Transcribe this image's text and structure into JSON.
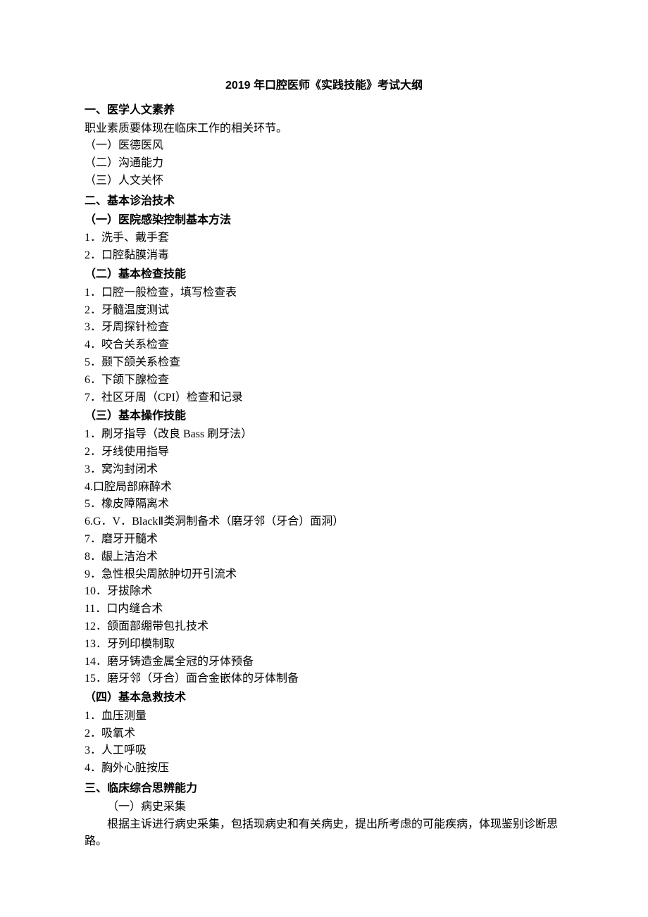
{
  "title": "2019 年口腔医师《实践技能》考试大纲",
  "s1": {
    "heading": "一、医学人文素养",
    "intro": "职业素质要体现在临床工作的相关环节。",
    "items": [
      "（一）医德医风",
      "（二）沟通能力",
      "（三）人文关怀"
    ]
  },
  "s2": {
    "heading": "二、基本诊治技术",
    "sub1": {
      "heading": "（一）医院感染控制基本方法",
      "items": [
        "1．洗手、戴手套",
        "2．口腔黏膜消毒"
      ]
    },
    "sub2": {
      "heading": "（二）基本检查技能",
      "items": [
        "1．口腔一般检查，填写检查表",
        "2．牙髓温度测试",
        "3．牙周探针检查",
        "4．咬合关系检查",
        "5．颞下颌关系检查",
        "6．下颌下腺检查",
        "7．社区牙周（CPI）检查和记录"
      ]
    },
    "sub3": {
      "heading": "（三）基本操作技能",
      "items": [
        "1．刷牙指导（改良 Bass 刷牙法）",
        "2．牙线使用指导",
        "3．窝沟封闭术",
        "4.口腔局部麻醉术",
        "5．橡皮障隔离术",
        "6.G．V．BlackⅡ类洞制备术（磨牙邻（牙合）面洞）",
        "7．磨牙开髓术",
        "8．龈上洁治术",
        "9．急性根尖周脓肿切开引流术",
        "10．牙拔除术",
        "11．口内缝合术",
        "12．颌面部绷带包扎技术",
        "13．牙列印模制取",
        "14．磨牙铸造金属全冠的牙体预备",
        "15．磨牙邻（牙合）面合金嵌体的牙体制备"
      ]
    },
    "sub4": {
      "heading": "（四）基本急救技术",
      "items": [
        "1．血压测量",
        "2．吸氧术",
        "3．人工呼吸",
        "4．胸外心脏按压"
      ]
    }
  },
  "s3": {
    "heading": "三、临床综合思辨能力",
    "sub1": {
      "heading": "（一）病史采集",
      "body": "根据主诉进行病史采集，包括现病史和有关病史，提出所考虑的可能疾病，体现鉴别诊断思路。"
    }
  }
}
